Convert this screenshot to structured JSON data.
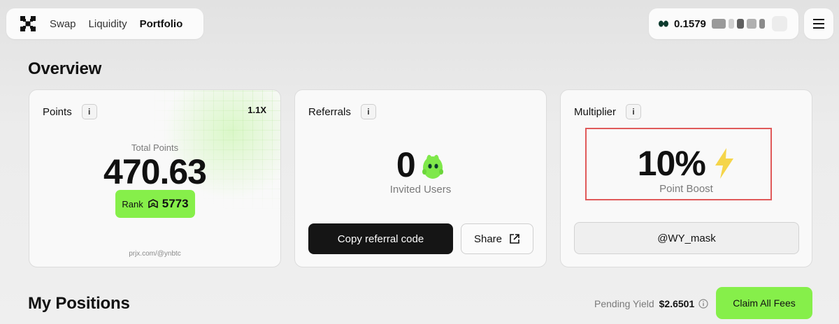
{
  "nav": {
    "logo_icon": "prjx-logo-icon",
    "links": [
      {
        "label": "Swap",
        "active": false
      },
      {
        "label": "Liquidity",
        "active": false
      },
      {
        "label": "Portfolio",
        "active": true
      }
    ]
  },
  "wallet": {
    "token_icon": "token-icon",
    "balance": "0.1579",
    "address_redacted": true
  },
  "menu": {
    "icon": "hamburger-menu-icon"
  },
  "overview": {
    "title": "Overview"
  },
  "points_card": {
    "title": "Points",
    "info_label": "i",
    "multiplier_tag": "1.1X",
    "total_label": "Total Points",
    "total_value": "470.63",
    "rank_label": "Rank",
    "rank_value": "5773",
    "footer_link": "prjx.com/@ynbtc"
  },
  "referrals_card": {
    "title": "Referrals",
    "info_label": "i",
    "invited_count": "0",
    "invited_label": "Invited Users",
    "copy_button": "Copy referral code",
    "share_button": "Share"
  },
  "multiplier_card": {
    "title": "Multiplier",
    "info_label": "i",
    "boost_value": "10%",
    "boost_label": "Point Boost",
    "handle_button": "@WY_mask"
  },
  "positions": {
    "title": "My Positions",
    "pending_label": "Pending Yield",
    "pending_value": "$2.6501",
    "claim_button": "Claim All Fees"
  },
  "colors": {
    "accent_green": "#86ef4a",
    "dark_button": "#151515",
    "highlight_red": "#e05a5a"
  }
}
